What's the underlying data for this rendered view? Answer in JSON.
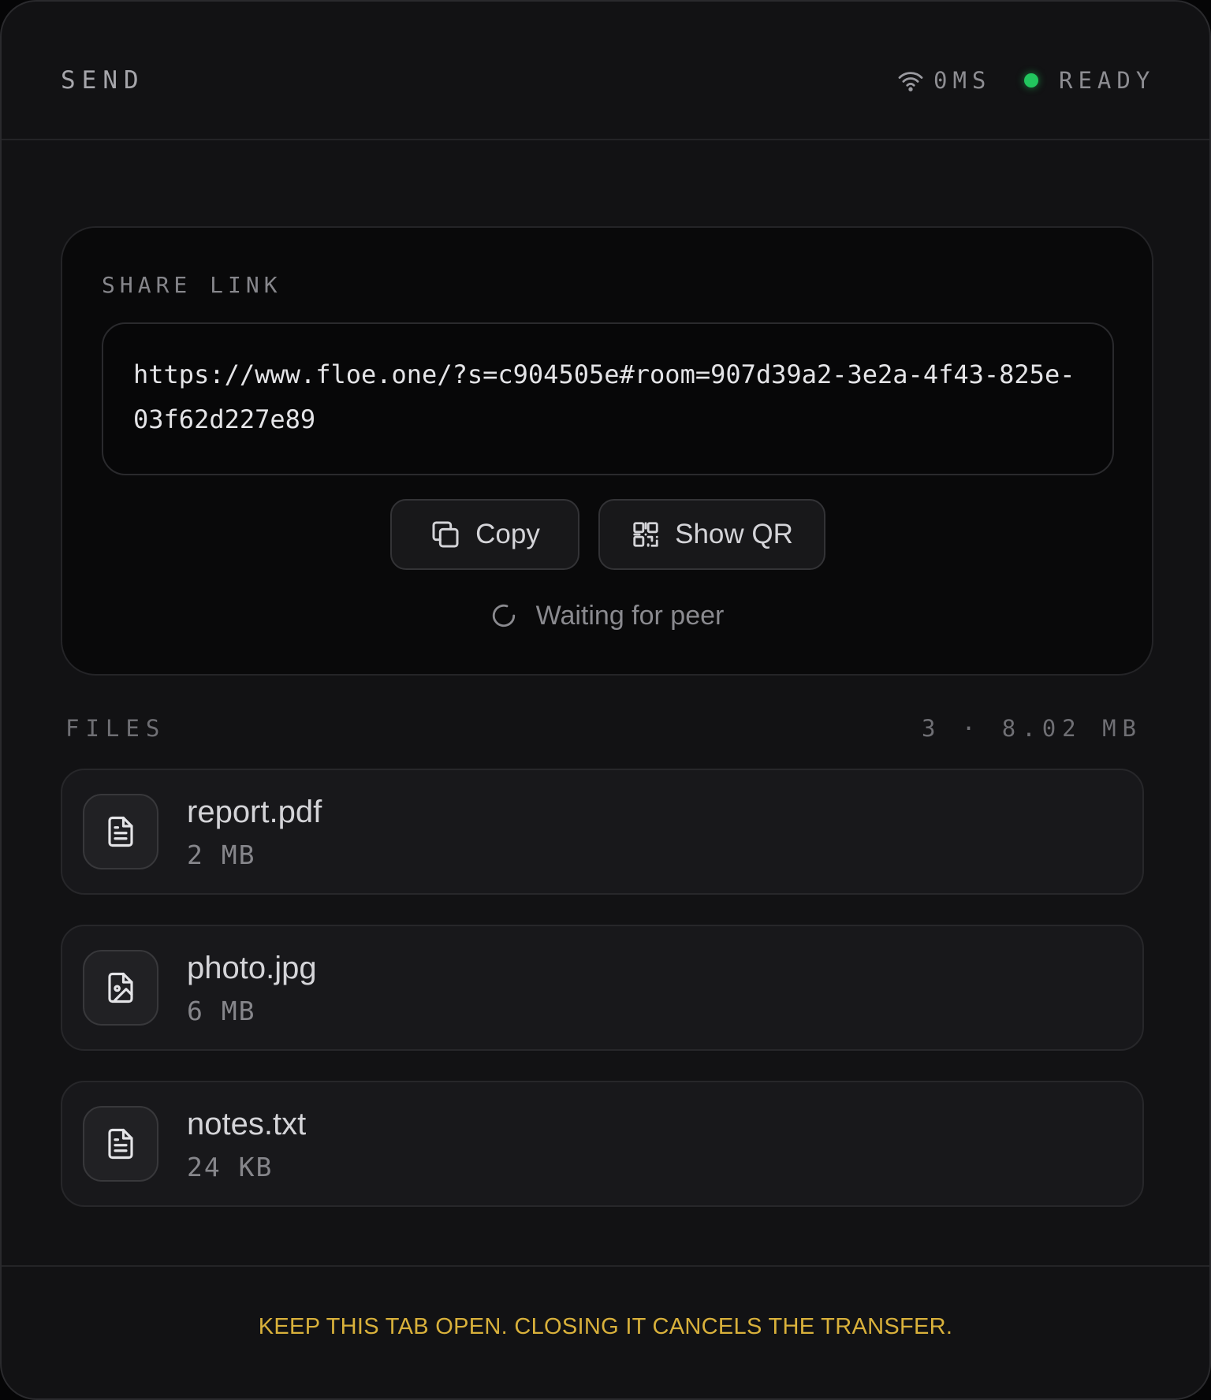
{
  "header": {
    "title": "SEND",
    "latency": "0MS",
    "status": "READY"
  },
  "share": {
    "label": "SHARE LINK",
    "link": "https://www.floe.one/?s=c904505e#room=907d39a2-3e2a-4f43-825e-03f62d227e89",
    "copy_label": "Copy",
    "qr_label": "Show QR",
    "waiting_text": "Waiting for peer"
  },
  "files": {
    "label": "FILES",
    "summary": "3 · 8.02 MB",
    "items": [
      {
        "name": "report.pdf",
        "size": "2 MB",
        "icon": "file-text-icon"
      },
      {
        "name": "photo.jpg",
        "size": "6 MB",
        "icon": "file-image-icon"
      },
      {
        "name": "notes.txt",
        "size": "24 KB",
        "icon": "file-text-icon"
      }
    ]
  },
  "footer": {
    "notice": "KEEP THIS TAB OPEN. CLOSING IT CANCELS THE TRANSFER."
  },
  "colors": {
    "status_ready": "#22c55e",
    "warning": "#d9b13b",
    "background": "#121214"
  }
}
